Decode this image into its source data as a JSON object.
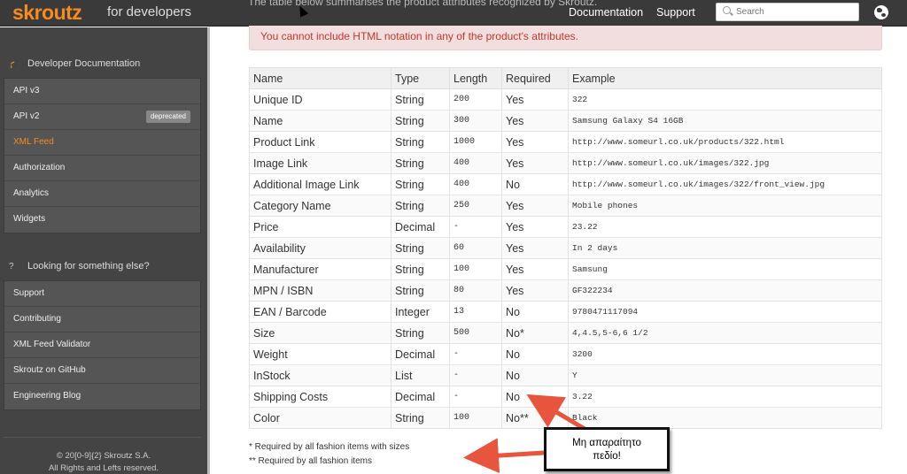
{
  "header": {
    "logo": "skroutz",
    "logo_sub": "for developers",
    "nav": [
      "Documentation",
      "Support"
    ],
    "search_placeholder": "Search"
  },
  "sidebar": {
    "section1_title": "Developer Documentation",
    "section1_items": [
      "API v3",
      "API v2",
      "XML Feed",
      "Authorization",
      "Analytics",
      "Widgets"
    ],
    "deprecated_badge": "deprecated",
    "active_item": "XML Feed",
    "section2_title": "Looking for something else?",
    "section2_items": [
      "Support",
      "Contributing",
      "XML Feed Validator",
      "Skroutz on GitHub",
      "Engineering Blog"
    ],
    "footer_line1": "© 20[0-9]{2} Skroutz S.A.",
    "footer_line2": "All Rights and Lefts reserved."
  },
  "main": {
    "faded_text": "The table below summarises the product attributes recognized by Skroutz.",
    "alert": "You cannot include HTML notation in any of the product's attributes.",
    "table": {
      "headers": [
        "Name",
        "Type",
        "Length",
        "Required",
        "Example"
      ],
      "rows": [
        [
          "Unique ID",
          "String",
          "200",
          "Yes",
          "322"
        ],
        [
          "Name",
          "String",
          "300",
          "Yes",
          "Samsung Galaxy S4 16GB"
        ],
        [
          "Product Link",
          "String",
          "1000",
          "Yes",
          "http://www.someurl.co.uk/products/322.html"
        ],
        [
          "Image Link",
          "String",
          "400",
          "Yes",
          "http://www.someurl.co.uk/images/322.jpg"
        ],
        [
          "Additional Image Link",
          "String",
          "400",
          "No",
          "http://www.someurl.co.uk/images/322/front_view.jpg"
        ],
        [
          "Category Name",
          "String",
          "250",
          "Yes",
          "Mobile phones"
        ],
        [
          "Price",
          "Decimal",
          "-",
          "Yes",
          "23.22"
        ],
        [
          "Availability",
          "String",
          "60",
          "Yes",
          "In 2 days"
        ],
        [
          "Manufacturer",
          "String",
          "100",
          "Yes",
          "Samsung"
        ],
        [
          "MPN / ISBN",
          "String",
          "80",
          "Yes",
          "GF322234"
        ],
        [
          "EAN / Barcode",
          "Integer",
          "13",
          "No",
          "9780471117094"
        ],
        [
          "Size",
          "String",
          "500",
          "No*",
          "4,4.5,5-6,6 1/2"
        ],
        [
          "Weight",
          "Decimal",
          "-",
          "No",
          "3200"
        ],
        [
          "InStock",
          "List",
          "-",
          "No",
          "Y"
        ],
        [
          "Shipping Costs",
          "Decimal",
          "-",
          "No",
          "3.22"
        ],
        [
          "Color",
          "String",
          "100",
          "No**",
          "Black"
        ]
      ]
    },
    "footnote1": "* Required by all fashion items with sizes",
    "footnote2": "** Required by all fashion items"
  },
  "annotation": {
    "line1": "Μη απαραίτητο",
    "line2": "πεδίο!",
    "arrow_color": "#e8553f"
  }
}
